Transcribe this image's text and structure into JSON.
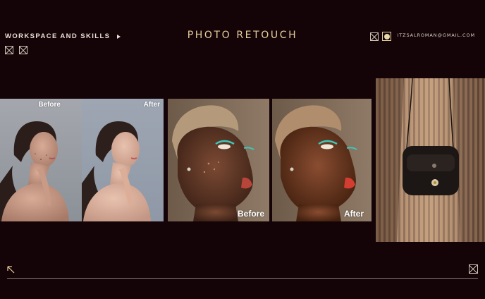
{
  "nav": {
    "section_label": "WORKSPACE AND SKILLS",
    "title": "PHOTO RETOUCH",
    "email": "ITZSALROMAN@GMAIL.COM"
  },
  "gallery": {
    "pair_one": {
      "before": "Before",
      "after": "After"
    },
    "pair_two": {
      "before": "Before",
      "after": "After"
    }
  },
  "colors": {
    "background": "#140307",
    "accent": "#e6cf9c",
    "text": "#e9e1d6"
  },
  "icons": {
    "nav_toggle": "play-triangle-icon",
    "boxes": "crossed-square-icon",
    "theme": "circle-square-icon",
    "back": "arrow-up-left-icon"
  }
}
